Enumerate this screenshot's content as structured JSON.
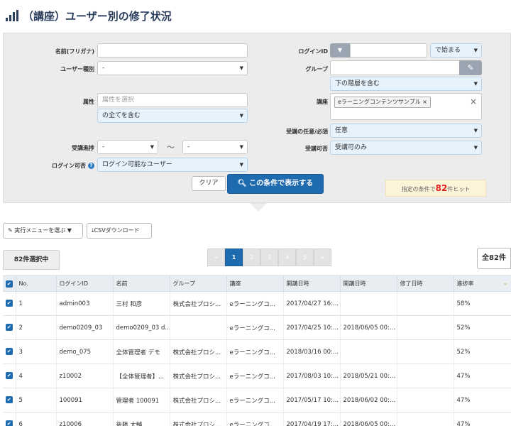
{
  "page": {
    "title": "（講座）ユーザー別の修了状況"
  },
  "filters": {
    "name_label": "名前(フリガナ)",
    "user_type_label": "ユーザー種別",
    "user_type_value": "-",
    "attribute_label": "属性",
    "attribute_placeholder": "属性を選択",
    "attribute_scope": "の全てを含む",
    "progress_label": "受講進捗",
    "progress_from": "-",
    "progress_tilde": "〜",
    "progress_to": "-",
    "login_allowed_label": "ログイン可否",
    "login_allowed_value": "ログイン可能なユーザー",
    "login_id_label": "ログインID",
    "login_id_match": "で始まる",
    "group_label": "グループ",
    "group_scope": "下の階層を含む",
    "course_label": "講座",
    "course_tag": "eラーニングコンテンツサンプル ×",
    "course_clear": "×",
    "required_label": "受講の任意/必須",
    "required_value": "任意",
    "enrollable_label": "受講可否",
    "enrollable_value": "受講可のみ",
    "clear_button": "クリア",
    "search_button": "この条件で表示する",
    "hit_prefix": "指定の条件で",
    "hit_count": "82",
    "hit_suffix": "件ヒット"
  },
  "actions": {
    "menu_button": "実行メニューを選ぶ",
    "csv_button": "CSVダウンロード",
    "selected_count": "82件選択中",
    "total": "全82件"
  },
  "pagination": {
    "prev": "«",
    "pages": [
      "1",
      "2",
      "3",
      "4",
      "5"
    ],
    "next": "»",
    "active": "1"
  },
  "table": {
    "columns": [
      "No.",
      "ログインID",
      "名前",
      "グループ",
      "講座",
      "開講日時",
      "開講日時",
      "修了日時",
      "進捗率"
    ],
    "rows": [
      [
        "1",
        "admin003",
        "三村 和彦",
        "株式会社プロシ...",
        "eラーニングコ...",
        "2017/04/27 16:...",
        "",
        "",
        "58%"
      ],
      [
        "2",
        "demo0209_03",
        "demo0209_03 d...",
        "",
        "eラーニングコ...",
        "2017/04/25 10:...",
        "2018/06/05 00:...",
        "",
        "52%"
      ],
      [
        "3",
        "demo_075",
        "全体管理者 デモ",
        "株式会社プロシ...",
        "eラーニングコ...",
        "2018/03/16 00:...",
        "",
        "",
        "52%"
      ],
      [
        "4",
        "z10002",
        "【全体管理者】...",
        "株式会社プロシ...",
        "eラーニングコ...",
        "2017/08/03 10:...",
        "2018/05/21 00:...",
        "",
        "47%"
      ],
      [
        "5",
        "100091",
        "管理者 100091",
        "株式会社プロシ...",
        "eラーニングコ...",
        "2017/05/17 10:...",
        "2018/06/02 00:...",
        "",
        "47%"
      ],
      [
        "6",
        "z10006",
        "後藤 大輔",
        "株式会社プロシ...",
        "eラーニングコ...",
        "2017/04/19 17:...",
        "2018/06/05 00:...",
        "",
        "47%"
      ]
    ]
  },
  "colors": {
    "brand": "#1f6bb0",
    "panel": "#ececec",
    "hit": "#e02020"
  }
}
